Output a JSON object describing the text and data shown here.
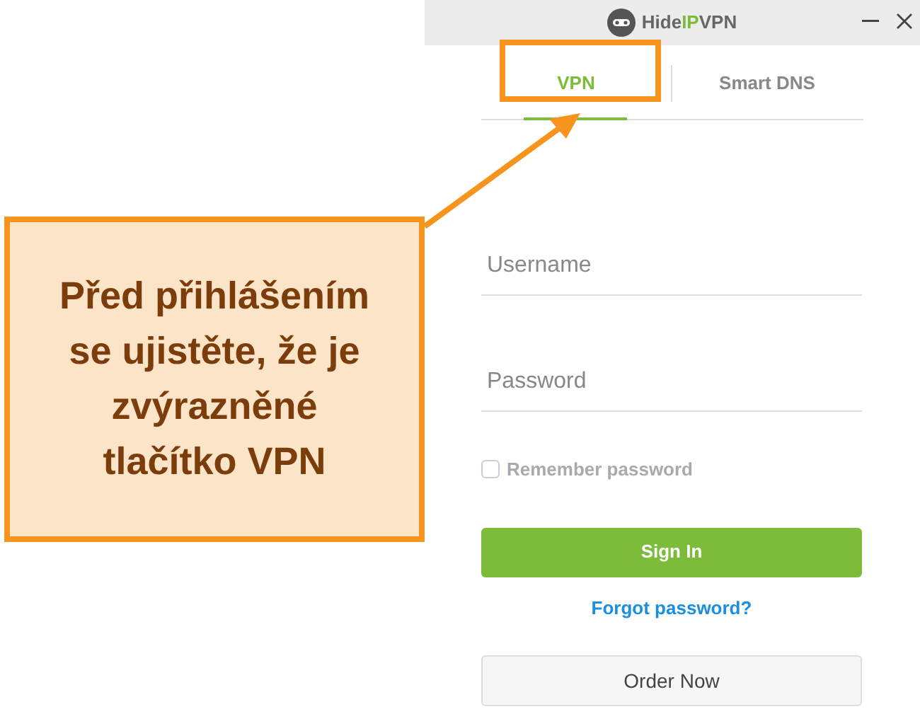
{
  "callout": {
    "text": "Před přihlášením se ujistěte, že je zvýrazněné tlačítko VPN"
  },
  "window": {
    "logo": [
      {
        "text": "Hide",
        "accent": false
      },
      {
        "text": "IP",
        "accent": true
      },
      {
        "text": "VPN",
        "accent": false
      }
    ]
  },
  "tabs": [
    {
      "label": "VPN",
      "selected": true,
      "highlighted": true
    },
    {
      "label": "Smart DNS",
      "selected": false,
      "highlighted": false
    }
  ],
  "fields": [
    {
      "placeholder": "Username"
    },
    {
      "placeholder": "Password"
    }
  ],
  "remember": {
    "label": "Remember password",
    "checked": false
  },
  "sign_in": "Sign In",
  "forgot_link": "Forgot password?",
  "order_button": "Order Now"
}
